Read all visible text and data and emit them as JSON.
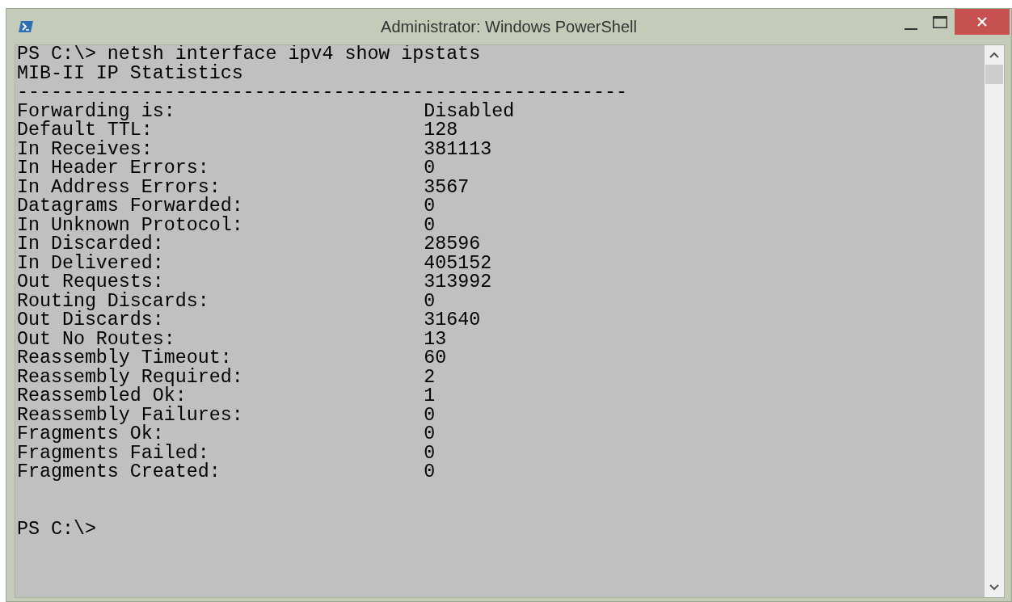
{
  "window": {
    "title": "Administrator: Windows PowerShell"
  },
  "console": {
    "lines": [
      {
        "kind": "text",
        "text": "PS C:\\> netsh interface ipv4 show ipstats"
      },
      {
        "kind": "text",
        "text": "MIB-II IP Statistics"
      },
      {
        "kind": "text",
        "text": "------------------------------------------------------"
      },
      {
        "kind": "stat",
        "label": "Forwarding is:",
        "value": "Disabled"
      },
      {
        "kind": "stat",
        "label": "Default TTL:",
        "value": "128"
      },
      {
        "kind": "stat",
        "label": "In Receives:",
        "value": "381113"
      },
      {
        "kind": "stat",
        "label": "In Header Errors:",
        "value": "0"
      },
      {
        "kind": "stat",
        "label": "In Address Errors:",
        "value": "3567"
      },
      {
        "kind": "stat",
        "label": "Datagrams Forwarded:",
        "value": "0"
      },
      {
        "kind": "stat",
        "label": "In Unknown Protocol:",
        "value": "0"
      },
      {
        "kind": "stat",
        "label": "In Discarded:",
        "value": "28596"
      },
      {
        "kind": "stat",
        "label": "In Delivered:",
        "value": "405152"
      },
      {
        "kind": "stat",
        "label": "Out Requests:",
        "value": "313992"
      },
      {
        "kind": "stat",
        "label": "Routing Discards:",
        "value": "0"
      },
      {
        "kind": "stat",
        "label": "Out Discards:",
        "value": "31640"
      },
      {
        "kind": "stat",
        "label": "Out No Routes:",
        "value": "13"
      },
      {
        "kind": "stat",
        "label": "Reassembly Timeout:",
        "value": "60"
      },
      {
        "kind": "stat",
        "label": "Reassembly Required:",
        "value": "2"
      },
      {
        "kind": "stat",
        "label": "Reassembled Ok:",
        "value": "1"
      },
      {
        "kind": "stat",
        "label": "Reassembly Failures:",
        "value": "0"
      },
      {
        "kind": "stat",
        "label": "Fragments Ok:",
        "value": "0"
      },
      {
        "kind": "stat",
        "label": "Fragments Failed:",
        "value": "0"
      },
      {
        "kind": "stat",
        "label": "Fragments Created:",
        "value": "0"
      },
      {
        "kind": "blank"
      },
      {
        "kind": "blank"
      },
      {
        "kind": "text",
        "text": "PS C:\\>"
      }
    ]
  }
}
